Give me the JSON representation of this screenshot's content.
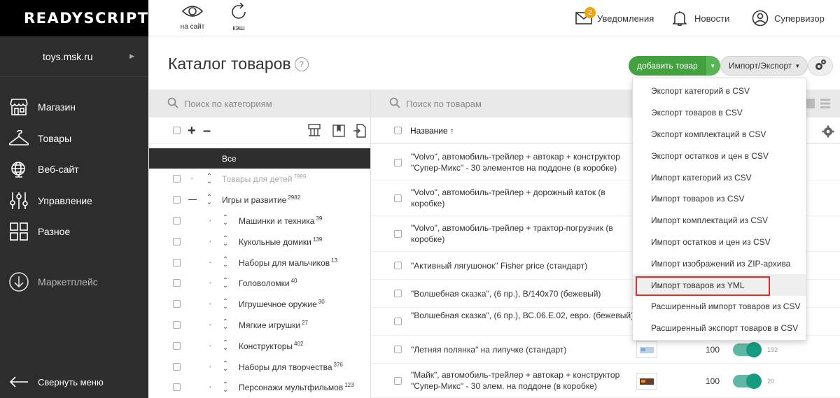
{
  "brand": {
    "logo": "READYSCRIPT"
  },
  "site": {
    "name": "toys.msk.ru"
  },
  "sidebar": {
    "items": [
      {
        "label": "Магазин",
        "icon": "shop-icon"
      },
      {
        "label": "Товары",
        "icon": "hanger-icon"
      },
      {
        "label": "Веб-сайт",
        "icon": "globe-icon"
      },
      {
        "label": "Управление",
        "icon": "sliders-icon"
      },
      {
        "label": "Разное",
        "icon": "grid-icon"
      }
    ],
    "marketplace": {
      "label": "Маркетплейс",
      "icon": "download-circle-icon"
    },
    "collapse": {
      "label": "Свернуть меню",
      "icon": "arrow-left-icon"
    }
  },
  "topbar": {
    "view_site": "на сайт",
    "cache": "кэш",
    "notifications": {
      "label": "Уведомления",
      "count": "2"
    },
    "news": "Новости",
    "user": "Супервизор"
  },
  "page": {
    "title": "Каталог товаров",
    "help": "?",
    "add_button": "добавить товар",
    "import_export": "Импорт/Экспорт"
  },
  "categories": {
    "search_placeholder": "Поиск по категориям",
    "all_label": "Все",
    "items": [
      {
        "name": "Товары для детей",
        "count": "7999",
        "level": 0,
        "disabled": true
      },
      {
        "name": "Игры и развитие",
        "count": "2982",
        "level": 0,
        "disabled": false,
        "expanded": true
      },
      {
        "name": "Машинки и техника",
        "count": "39",
        "level": 1
      },
      {
        "name": "Кукольные домики",
        "count": "139",
        "level": 1
      },
      {
        "name": "Наборы для мальчиков",
        "count": "13",
        "level": 1
      },
      {
        "name": "Головоломки",
        "count": "40",
        "level": 1
      },
      {
        "name": "Игрушечное оружие",
        "count": "30",
        "level": 1
      },
      {
        "name": "Мягкие игрушки",
        "count": "27",
        "level": 1
      },
      {
        "name": "Конструкторы",
        "count": "402",
        "level": 1
      },
      {
        "name": "Наборы для творчества",
        "count": "376",
        "level": 1
      },
      {
        "name": "Персонажи мультфильмов",
        "count": "123",
        "level": 1
      }
    ]
  },
  "products": {
    "search_placeholder": "Поиск по товарам",
    "column_name": "Название",
    "sort_arrow": "↑",
    "rows": [
      {
        "name": "\"Volvo\", автомобиль-трейлер + автокар + конструктор \"Супер-Микс\" - 30 элементов на поддоне (в коробке)"
      },
      {
        "name": "\"Volvo\", автомобиль-трейлер + дорожный каток (в коробке)"
      },
      {
        "name": "\"Volvo\", автомобиль-трейлер + трактор-погрузчик (в коробке)"
      },
      {
        "name": "\"Активный лягушонок\" Fisher price (стандарт)"
      },
      {
        "name": "\"Волшебная сказка\", (6 пр.), В/140х70 (бежевый)"
      },
      {
        "name": "\"Волшебная сказка\", (6 пр.), ВС.06.Е.02, евро. (бежевый)"
      },
      {
        "name": "\"Летняя полянка\" на липучке (стандарт)",
        "qty": "100",
        "id": "192"
      },
      {
        "name": "\"Майк\", автомобиль-трейлер + автокар + конструктор \"Супер-Микс\" - 30 элем. на поддоне (в коробке)",
        "qty": "100",
        "id": "20"
      }
    ]
  },
  "dropdown": {
    "items": [
      "Экспорт категорий в CSV",
      "Экспорт товаров в CSV",
      "Экспорт комплектаций в CSV",
      "Экспорт остатков и цен в CSV",
      "Импорт категорий из CSV",
      "Импорт товаров из CSV",
      "Импорт комплектаций из CSV",
      "Импорт остатков и цен из CSV",
      "Импорт изображений из ZIP-архива",
      "Импорт товаров из YML",
      "Расширенный импорт товаров из CSV",
      "Расширенный экспорт товаров в CSV"
    ],
    "highlighted_index": 9
  },
  "colors": {
    "accent_green": "#43a13f",
    "highlight_red": "#d9302c",
    "toggle_teal": "#179b80"
  }
}
